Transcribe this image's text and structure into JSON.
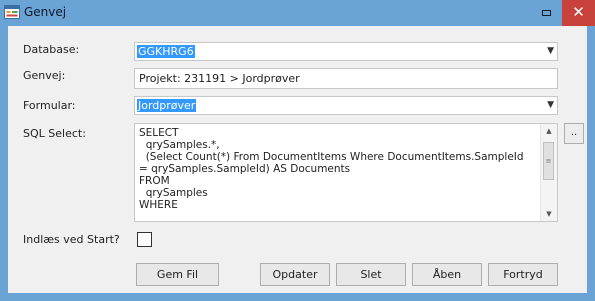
{
  "window": {
    "title": "Genvej",
    "close_glyph": "✕",
    "app_icon": "form-icon",
    "colors": {
      "titlebar": "#6aa3d6",
      "close": "#c8413a",
      "selection": "#3399ff"
    }
  },
  "form": {
    "database": {
      "label": "Database:",
      "value": "GGKHRG6"
    },
    "genvej": {
      "label": "Genvej:",
      "value": "Projekt: 231191 > Jordprøver"
    },
    "formular": {
      "label": "Formular:",
      "value": "Jordprøver"
    },
    "sql": {
      "label": "SQL Select:",
      "text": "SELECT\n  qrySamples.*,\n  (Select Count(*) From DocumentItems Where DocumentItems.SampleId = qrySamples.SampleId) AS Documents\nFROM\n  qrySamples\nWHERE",
      "browse_label": ".."
    },
    "startup": {
      "label": "Indlæs ved Start?",
      "checked": false
    }
  },
  "buttons": {
    "save": "Gem Fil",
    "update": "Opdater",
    "delete": "Slet",
    "open": "Åben",
    "cancel": "Fortryd"
  }
}
